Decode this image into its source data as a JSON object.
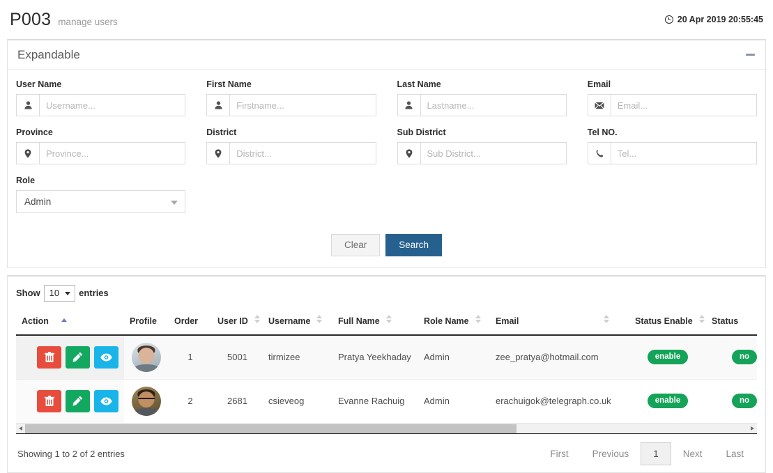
{
  "header": {
    "code": "P003",
    "subtitle": "manage users",
    "clock_icon": "clock-icon",
    "datetime": "20 Apr 2019 20:55:45"
  },
  "search_panel": {
    "title": "Expandable",
    "collapse_icon": "minus-icon",
    "fields": [
      {
        "label": "User Name",
        "placeholder": "Username...",
        "value": "",
        "icon": "user-icon"
      },
      {
        "label": "First Name",
        "placeholder": "Firstname...",
        "value": "",
        "icon": "user-icon"
      },
      {
        "label": "Last Name",
        "placeholder": "Lastname...",
        "value": "",
        "icon": "user-icon"
      },
      {
        "label": "Email",
        "placeholder": "Email...",
        "value": "",
        "icon": "envelope-icon"
      },
      {
        "label": "Province",
        "placeholder": "Province...",
        "value": "",
        "icon": "map-marker-icon"
      },
      {
        "label": "District",
        "placeholder": "District...",
        "value": "",
        "icon": "map-marker-icon"
      },
      {
        "label": "Sub District",
        "placeholder": "Sub District...",
        "value": "",
        "icon": "map-marker-icon"
      },
      {
        "label": "Tel NO.",
        "placeholder": "Tel...",
        "value": "",
        "icon": "phone-icon"
      }
    ],
    "role": {
      "label": "Role",
      "selected": "Admin",
      "caret_icon": "chevron-down-icon"
    },
    "buttons": {
      "clear": "Clear",
      "search": "Search"
    },
    "colors": {
      "search_button": "#26608e",
      "clear_button": "#f4f4f4"
    }
  },
  "table_panel": {
    "length": {
      "show_label": "Show",
      "value": "10",
      "entries_label": "entries",
      "caret_icon": "chevron-down-icon"
    },
    "columns": [
      {
        "key": "action",
        "label": "Action",
        "sort": "asc"
      },
      {
        "key": "profile",
        "label": "Profile",
        "sort": "none"
      },
      {
        "key": "order",
        "label": "Order",
        "sort": "none"
      },
      {
        "key": "user_id",
        "label": "User ID",
        "sort": "both"
      },
      {
        "key": "username",
        "label": "Username",
        "sort": "both"
      },
      {
        "key": "full_name",
        "label": "Full Name",
        "sort": "both"
      },
      {
        "key": "role_name",
        "label": "Role Name",
        "sort": "both"
      },
      {
        "key": "email",
        "label": "Email",
        "sort": "both"
      },
      {
        "key": "status_en",
        "label": "Status Enable",
        "sort": "both"
      },
      {
        "key": "status",
        "label": "Status",
        "sort": "none"
      }
    ],
    "row_actions": [
      {
        "name": "delete-button",
        "icon": "trash-icon",
        "color": "#e84c3d"
      },
      {
        "name": "edit-button",
        "icon": "pencil-icon",
        "color": "#12a860"
      },
      {
        "name": "view-button",
        "icon": "eye-icon",
        "color": "#19b5e8"
      }
    ],
    "rows": [
      {
        "order": "1",
        "user_id": "5001",
        "username": "tirmizee",
        "full_name": "Pratya Yeekhaday",
        "role_name": "Admin",
        "email": "zee_pratya@hotmail.com",
        "status_enable": "enable",
        "status": "no"
      },
      {
        "order": "2",
        "user_id": "2681",
        "username": "csieveog",
        "full_name": "Evanne Rachuig",
        "role_name": "Admin",
        "email": "erachuigok@telegraph.co.uk",
        "status_enable": "enable",
        "status": "no"
      }
    ],
    "info": "Showing 1 to 2 of 2 entries",
    "pagination": {
      "first": "First",
      "previous": "Previous",
      "current_page": "1",
      "next": "Next",
      "last": "Last"
    },
    "scrollbar": {
      "left_arrow_icon": "caret-left-icon",
      "right_arrow_icon": "caret-right-icon"
    }
  }
}
